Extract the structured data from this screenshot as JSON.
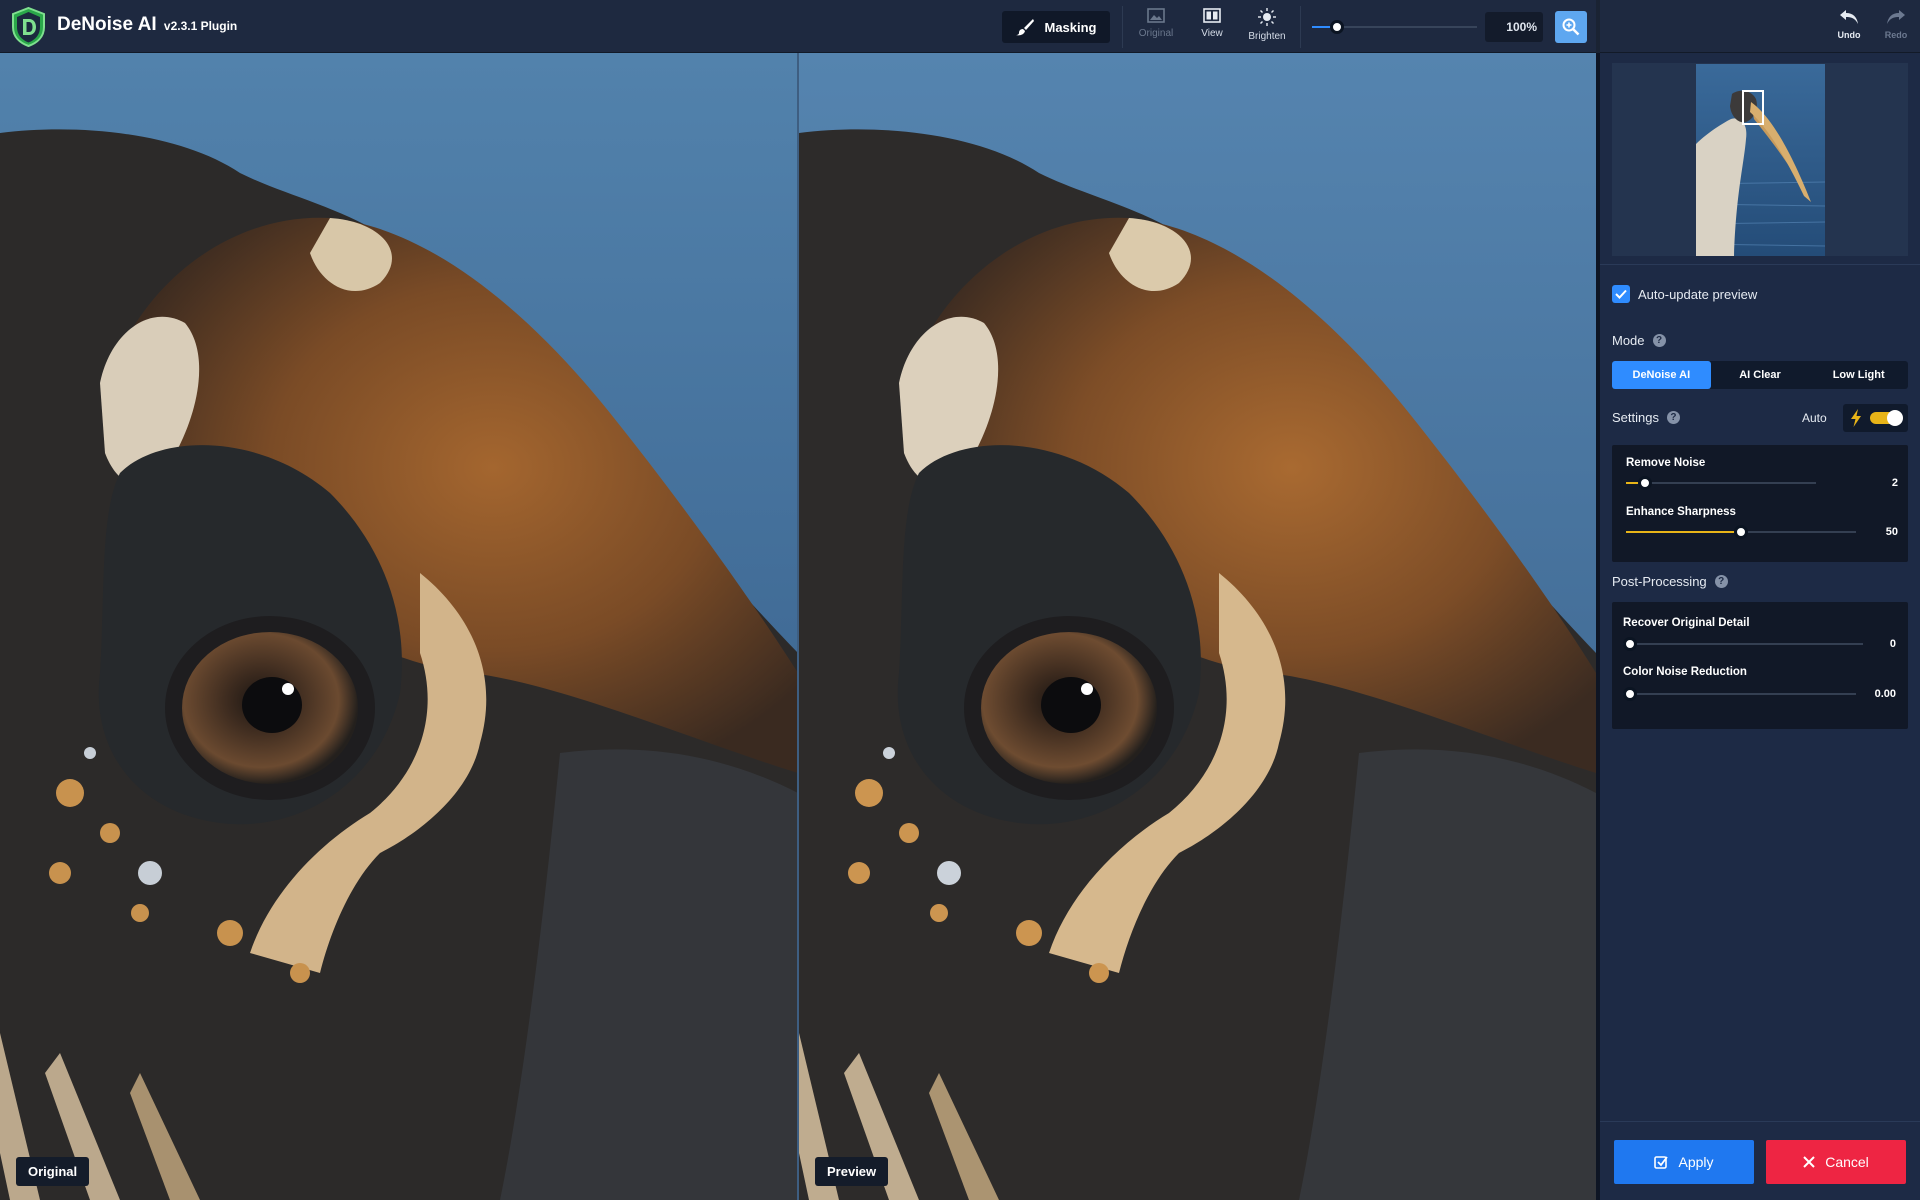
{
  "app": {
    "name": "DeNoise AI",
    "version": "v2.3.1 Plugin"
  },
  "toolbar": {
    "masking_label": "Masking",
    "original_label": "Original",
    "view_label": "View",
    "brighten_label": "Brighten",
    "zoom_value": "100%",
    "zoom_slider_fraction": 0.12
  },
  "history": {
    "undo_label": "Undo",
    "redo_label": "Redo"
  },
  "views": {
    "left_label": "Original",
    "right_label": "Preview"
  },
  "panel": {
    "auto_update_label": "Auto-update preview",
    "auto_update_checked": true,
    "mode_label": "Mode",
    "modes": [
      {
        "label": "DeNoise AI",
        "active": true
      },
      {
        "label": "AI Clear",
        "active": false
      },
      {
        "label": "Low Light",
        "active": false
      }
    ],
    "settings_label": "Settings",
    "auto_label": "Auto",
    "auto_enabled": true,
    "sliders": [
      {
        "label": "Remove Noise",
        "value": "2",
        "fraction": 0.07
      },
      {
        "label": "Enhance Sharpness",
        "value": "50",
        "fraction": 0.5
      }
    ],
    "post_processing_label": "Post-Processing",
    "post_sliders": [
      {
        "label": "Recover Original Detail",
        "value": "0",
        "fraction": 0.0
      },
      {
        "label": "Color Noise Reduction",
        "value": "0.00",
        "fraction": 0.0
      }
    ],
    "help_glyph": "?",
    "apply_label": "Apply",
    "cancel_label": "Cancel"
  },
  "colors": {
    "accent": "#2f8cff",
    "apply": "#1f78f0",
    "cancel": "#ee2543",
    "toggle": "#e8b418",
    "panel_bg": "#1d2a45",
    "topbar_bg": "#1e2940"
  },
  "icons": [
    "logo-icon",
    "brush-icon",
    "image-icon",
    "compare-view-icon",
    "sun-icon",
    "zoom-icon",
    "undo-icon",
    "redo-icon",
    "checkmark-icon",
    "help-icon",
    "lightning-icon",
    "apply-icon",
    "close-icon"
  ]
}
